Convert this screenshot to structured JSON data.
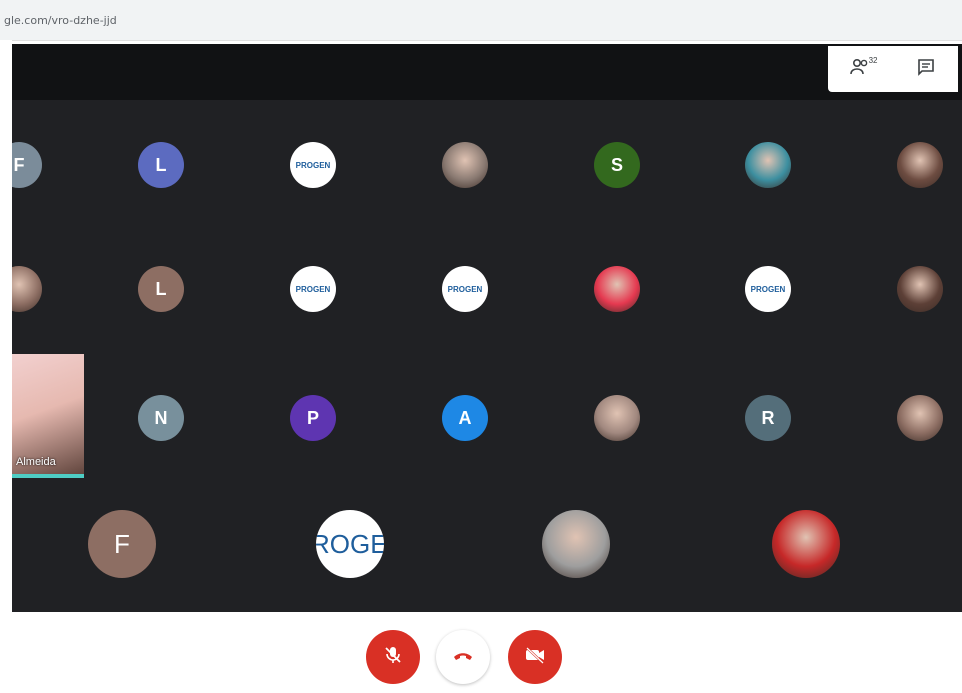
{
  "browser": {
    "url": "gle.com/vro-dzhe-jjd"
  },
  "topbar": {
    "participants_count": "32",
    "people_icon": "people-icon",
    "chat_icon": "chat-icon"
  },
  "self_tile": {
    "name": "Almeida"
  },
  "participants": [
    {
      "label": "F",
      "color": "#7b8c9a"
    },
    {
      "label": "L",
      "color": "#5c6bc0"
    },
    {
      "label": "PROGEN",
      "color": "#ffffff"
    },
    {
      "label": "",
      "color": "#8a7a72"
    },
    {
      "label": "S",
      "color": "#33691e"
    },
    {
      "label": "",
      "color": "#3c8fa0"
    },
    {
      "label": "",
      "color": "#6d4c41"
    },
    {
      "label": "",
      "color": "#8d6e63"
    },
    {
      "label": "L",
      "color": "#8d6e63"
    },
    {
      "label": "PROGEN",
      "color": "#ffffff"
    },
    {
      "label": "PROGEN",
      "color": "#ffffff"
    },
    {
      "label": "",
      "color": "#e53950"
    },
    {
      "label": "PROGEN",
      "color": "#ffffff"
    },
    {
      "label": "",
      "color": "#5d4037"
    },
    {
      "label": "N",
      "color": "#78909c"
    },
    {
      "label": "P",
      "color": "#5e35b1"
    },
    {
      "label": "A",
      "color": "#1e88e5"
    },
    {
      "label": "",
      "color": "#a1887f"
    },
    {
      "label": "R",
      "color": "#546e7a"
    },
    {
      "label": "",
      "color": "#8d6e63"
    },
    {
      "label": "F",
      "color": "#8d6e63"
    },
    {
      "label": "PROGEN",
      "color": "#ffffff"
    },
    {
      "label": "",
      "color": "#9e9e9e"
    },
    {
      "label": "",
      "color": "#c62828"
    }
  ],
  "controls": {
    "mic_icon": "mic-off-icon",
    "hangup_icon": "hang-up-icon",
    "camera_icon": "camera-off-icon"
  }
}
